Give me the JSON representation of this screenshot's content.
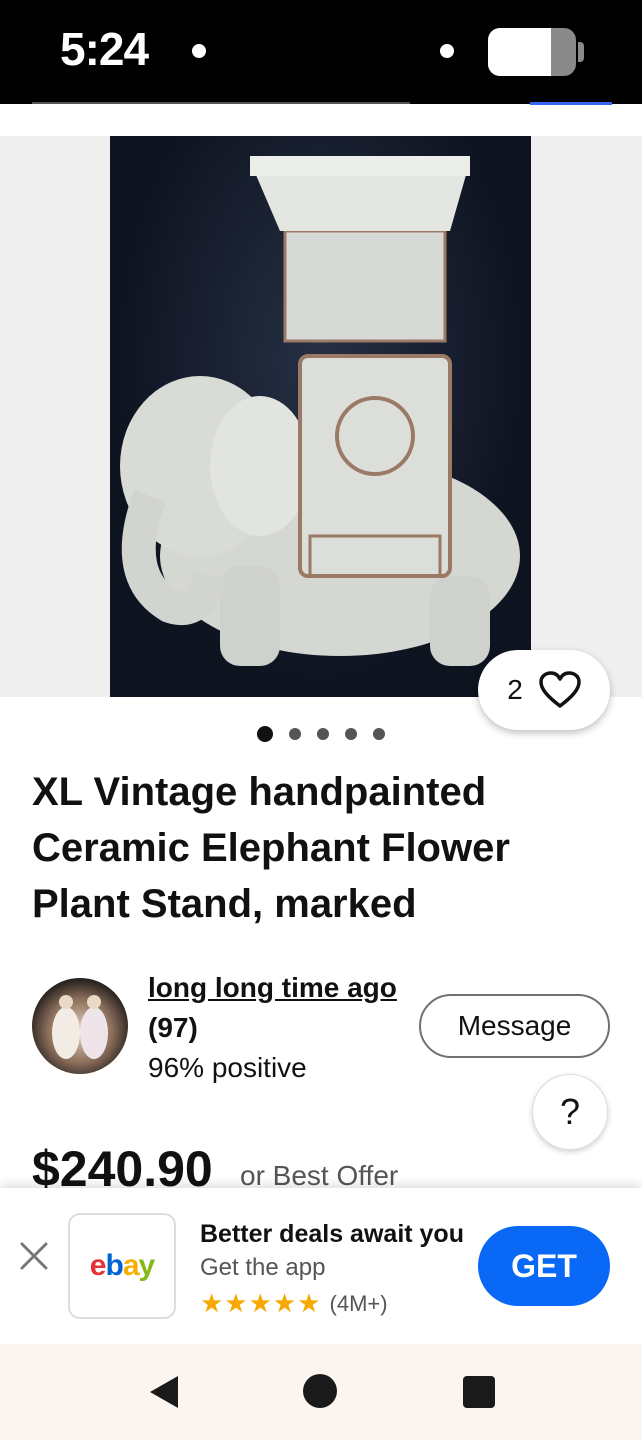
{
  "status_bar": {
    "time": "5:24",
    "battery_level": 0.72
  },
  "gallery": {
    "image_count": 5,
    "active_index": 0,
    "image_alt": "Ceramic elephant plant stand photo"
  },
  "watch": {
    "count": "2",
    "icon": "heart-icon"
  },
  "listing": {
    "title": "XL Vintage handpainted Ceramic Elephant Flower Plant Stand, marked",
    "price": "$240.90",
    "price_note": "or Best Offer"
  },
  "seller": {
    "name": "long long time ago",
    "feedback_count": "(97)",
    "positive": "96% positive",
    "message_label": "Message"
  },
  "help": {
    "label": "?"
  },
  "app_banner": {
    "logo_letters": [
      "e",
      "b",
      "a",
      "y"
    ],
    "headline": "Better deals await you",
    "subtitle": "Get the app",
    "stars": "★★★★★",
    "rating_count": "(4M+)",
    "cta": "GET",
    "close_icon": "close-icon"
  },
  "colors": {
    "accent": "#0968f6",
    "ebay_red": "#e53238",
    "ebay_blue": "#0064d2",
    "ebay_yellow": "#f5af02",
    "ebay_green": "#86b817",
    "star": "#f5a800"
  }
}
